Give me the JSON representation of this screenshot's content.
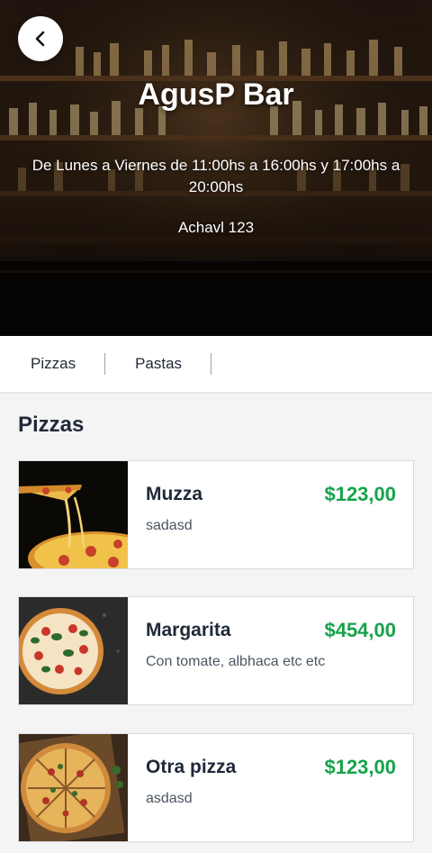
{
  "header": {
    "bar_name": "AgusP Bar",
    "hours": "De Lunes a Viernes de 11:00hs a 16:00hs y 17:00hs a 20:00hs",
    "address": "Achavl 123",
    "back_icon": "chevron-left-icon"
  },
  "tabs": [
    {
      "label": "Pizzas"
    },
    {
      "label": "Pastas"
    }
  ],
  "section": {
    "title": "Pizzas",
    "items": [
      {
        "name": "Muzza",
        "price": "$123,00",
        "description": "sadasd"
      },
      {
        "name": "Margarita",
        "price": "$454,00",
        "description": "Con tomate, albhaca etc etc"
      },
      {
        "name": "Otra pizza",
        "price": "$123,00",
        "description": "asdasd"
      }
    ]
  },
  "colors": {
    "price_green": "#16a34a",
    "text_dark": "#1f2937",
    "background": "#f4f4f5"
  }
}
